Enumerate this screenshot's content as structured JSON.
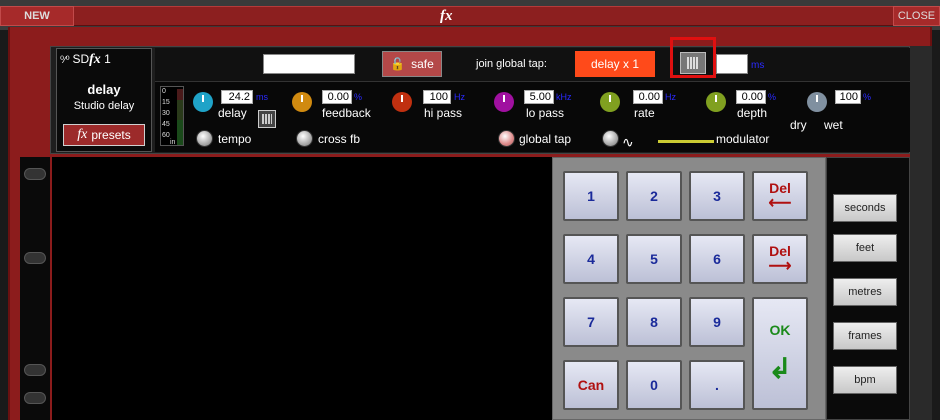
{
  "window": {
    "new_label": "NEW",
    "title": "fx",
    "close_label": "CLOSE"
  },
  "unit": {
    "name": "SD",
    "fx": "fx",
    "number": "1",
    "effect": "delay",
    "subtitle": "Studio delay",
    "presets_fx": "fx",
    "presets_label": "presets"
  },
  "toolbar": {
    "name_value": "",
    "safe_label": "safe",
    "join_tap_label": "join global tap:",
    "delay_mult": "delay x 1",
    "tap_value": "",
    "tap_unit": "ms"
  },
  "meter": {
    "ticks": [
      "0",
      "15",
      "30",
      "45",
      "60"
    ],
    "in_label": "in"
  },
  "params": {
    "delay": {
      "value": "24.2",
      "unit": "ms",
      "label": "delay"
    },
    "tempo": {
      "label": "tempo"
    },
    "feedback": {
      "value": "0.00",
      "unit": "%",
      "label": "feedback"
    },
    "cross_fb": {
      "label": "cross fb"
    },
    "hi_pass": {
      "value": "100",
      "unit": "Hz",
      "label": "hi pass"
    },
    "lo_pass": {
      "value": "5.00",
      "unit": "kHz",
      "label": "lo pass"
    },
    "global_tap": {
      "label": "global tap"
    },
    "rate": {
      "value": "0.00",
      "unit": "Hz",
      "label": "rate"
    },
    "depth": {
      "value": "0.00",
      "unit": "%",
      "label": "depth"
    },
    "modulator": {
      "label": "modulator"
    },
    "drywet": {
      "value": "100",
      "unit": "%",
      "dry_label": "dry",
      "wet_label": "wet"
    }
  },
  "keypad": {
    "k1": "1",
    "k2": "2",
    "k3": "3",
    "k4": "4",
    "k5": "5",
    "k6": "6",
    "k7": "7",
    "k8": "8",
    "k9": "9",
    "k0": "0",
    "dot": ".",
    "can": "Can",
    "del": "Del",
    "ok": "OK"
  },
  "units": {
    "seconds": "seconds",
    "feet": "feet",
    "metres": "metres",
    "frames": "frames",
    "bpm": "bpm"
  },
  "colors": {
    "delay_knob": "#1fa3c8",
    "feedback_knob": "#d08a10",
    "hipass_knob": "#c03010",
    "lopass_knob": "#a010a0",
    "rate_knob": "#80a020",
    "depth_knob": "#80a020",
    "drywet_knob": "#8090a0",
    "accent": "#ff4a1a"
  }
}
